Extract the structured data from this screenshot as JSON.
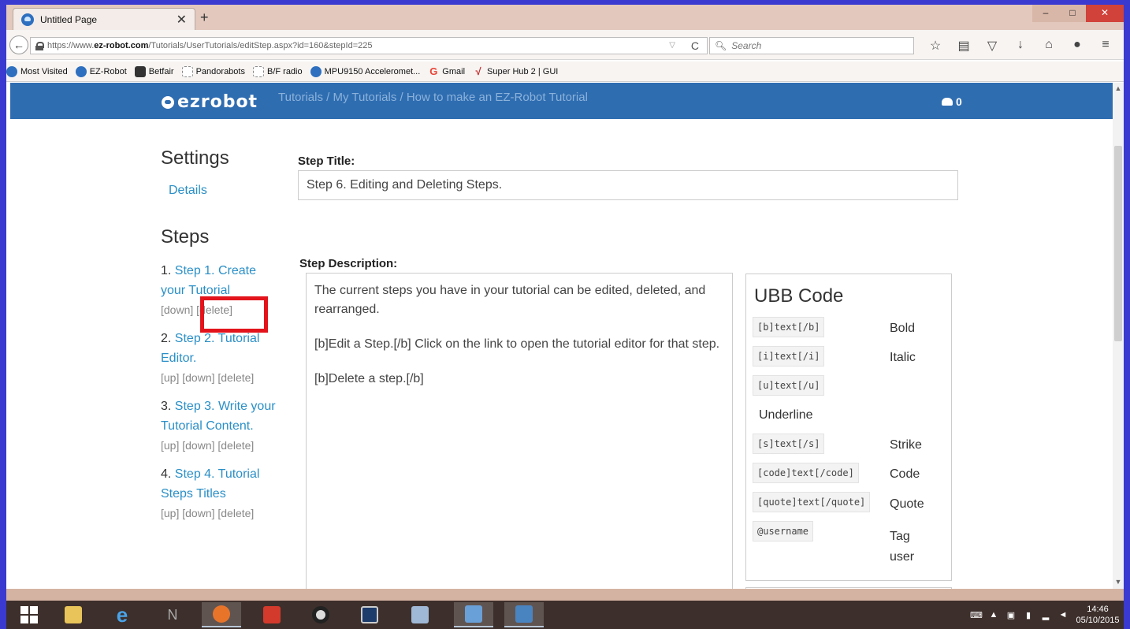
{
  "browser": {
    "tab_title": "Untitled Page",
    "tab_close": "✕",
    "new_tab": "+",
    "url_prefix": "https://www.",
    "url_domain": "ez-robot.com",
    "url_path": "/Tutorials/UserTutorials/editStep.aspx?id=160&stepId=225",
    "search_placeholder": "Search",
    "bookmarks": [
      {
        "label": "Most Visited",
        "icon": "most-visited-icon"
      },
      {
        "label": "EZ-Robot",
        "icon": "ez-robot-icon"
      },
      {
        "label": "Betfair",
        "icon": "betfair-icon"
      },
      {
        "label": "Pandorabots",
        "icon": "page-icon"
      },
      {
        "label": "B/F radio",
        "icon": "page-icon"
      },
      {
        "label": "MPU9150 Acceleromet...",
        "icon": "ez-robot-icon"
      },
      {
        "label": "Gmail",
        "icon": "google-icon"
      },
      {
        "label": "Super Hub 2 | GUI",
        "icon": "check-icon"
      }
    ]
  },
  "site": {
    "logo": "ezrobot",
    "breadcrumb": "Tutorials / My Tutorials / How to make an EZ-Robot Tutorial",
    "cart_count": "0"
  },
  "sidebar": {
    "settings_title": "Settings",
    "details_link": "Details",
    "steps_title": "Steps",
    "steps": [
      {
        "num": "1.",
        "title": "Step 1. Create your Tutorial",
        "controls": "[down] [delete]"
      },
      {
        "num": "2.",
        "title": "Step 2. Tutorial Editor.",
        "controls": "[up] [down] [delete]"
      },
      {
        "num": "3.",
        "title": "Step 3. Write your Tutorial Content.",
        "controls": "[up] [down] [delete]"
      },
      {
        "num": "4.",
        "title": "Step 4. Tutorial Steps Titles",
        "controls": "[up] [down] [delete]"
      }
    ]
  },
  "form": {
    "title_label": "Step Title:",
    "title_value": "Step 6. Editing and Deleting Steps.",
    "description_label": "Step Description:",
    "description_paragraphs": [
      "The current steps you have in your tutorial can be edited, deleted, and rearranged.",
      "[b]Edit a Step.[/b] Click on the link to open the tutorial editor for that step.",
      "[b]Delete a step.[/b]"
    ]
  },
  "ubb": {
    "title": "UBB Code",
    "rows": [
      {
        "code": "[b]text[/b]",
        "desc": "Bold"
      },
      {
        "code": "[i]text[/i]",
        "desc": "Italic"
      },
      {
        "code": "[u]text[/u]",
        "desc": "Underline"
      },
      {
        "code": "[s]text[/s]",
        "desc": "Strike"
      },
      {
        "code": "[code]text[/code]",
        "desc": "Code"
      },
      {
        "code": "[quote]text[/quote]",
        "desc": "Quote"
      },
      {
        "code": "@username",
        "desc": "Tag user"
      }
    ]
  },
  "taskbar": {
    "time": "14:46",
    "date": "05/10/2015"
  },
  "colors": {
    "header_blue": "#2f6db1",
    "link_blue": "#2a8fc7",
    "highlight_red": "#e3141b"
  }
}
